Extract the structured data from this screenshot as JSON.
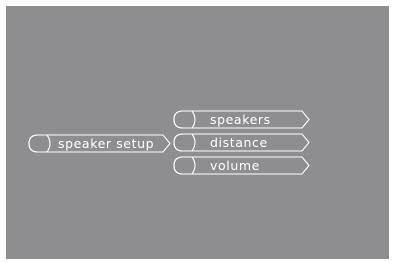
{
  "menu": {
    "root_item": {
      "label": "speaker setup",
      "icon": "radio-cap-icon"
    },
    "submenu": [
      {
        "label": "speakers",
        "icon": "radio-cap-icon"
      },
      {
        "label": "distance",
        "icon": "radio-cap-icon"
      },
      {
        "label": "volume",
        "icon": "radio-cap-icon"
      }
    ]
  },
  "colors": {
    "screen_background": "#8e8e90",
    "outline": "#ffffff",
    "text": "#ffffff"
  }
}
